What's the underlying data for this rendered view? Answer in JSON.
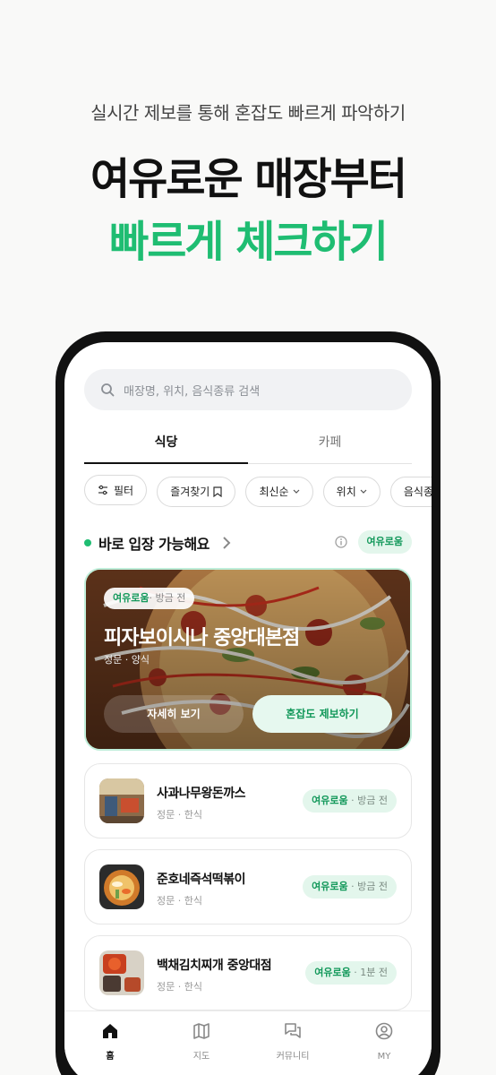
{
  "promo": {
    "subtitle": "실시간 제보를 통해 혼잡도 빠르게 파악하기",
    "headline_line1": "여유로운 매장부터",
    "headline_line2": "빠르게 체크하기",
    "accent_color": "#1fbd72"
  },
  "search": {
    "placeholder": "매장명, 위치, 음식종류 검색",
    "icon": "search-icon"
  },
  "tabs": [
    {
      "label": "식당",
      "active": true
    },
    {
      "label": "카페",
      "active": false
    }
  ],
  "filters": [
    {
      "label": "필터",
      "icon": "sliders-icon"
    },
    {
      "label": "즐겨찾기",
      "icon": "bookmark-icon"
    },
    {
      "label": "최신순",
      "icon": "chevron-down-icon"
    },
    {
      "label": "위치",
      "icon": "chevron-down-icon"
    },
    {
      "label": "음식종류",
      "icon": "chevron-down-icon"
    }
  ],
  "section": {
    "title": "바로 입장 가능해요",
    "status": "여유로움"
  },
  "featured": {
    "status": "여유로움",
    "time": "· 방금 전",
    "name": "피자보이시나 중앙대본점",
    "category": "정문 · 양식",
    "detail_button": "자세히 보기",
    "report_button": "혼잡도 제보하기"
  },
  "stores": [
    {
      "name": "사과나무왕돈까스",
      "category": "정문 · 한식",
      "status": "여유로움",
      "time": " · 방금 전"
    },
    {
      "name": "준호네즉석떡볶이",
      "category": "정문 · 한식",
      "status": "여유로움",
      "time": " · 방금 전"
    },
    {
      "name": "백채김치찌개 중앙대점",
      "category": "정문 · 한식",
      "status": "여유로움",
      "time": " · 1분 전"
    }
  ],
  "nav": [
    {
      "label": "홈",
      "icon": "home-icon",
      "active": true
    },
    {
      "label": "지도",
      "icon": "map-icon",
      "active": false
    },
    {
      "label": "커뮤니티",
      "icon": "community-icon",
      "active": false
    },
    {
      "label": "MY",
      "icon": "profile-icon",
      "active": false
    }
  ]
}
